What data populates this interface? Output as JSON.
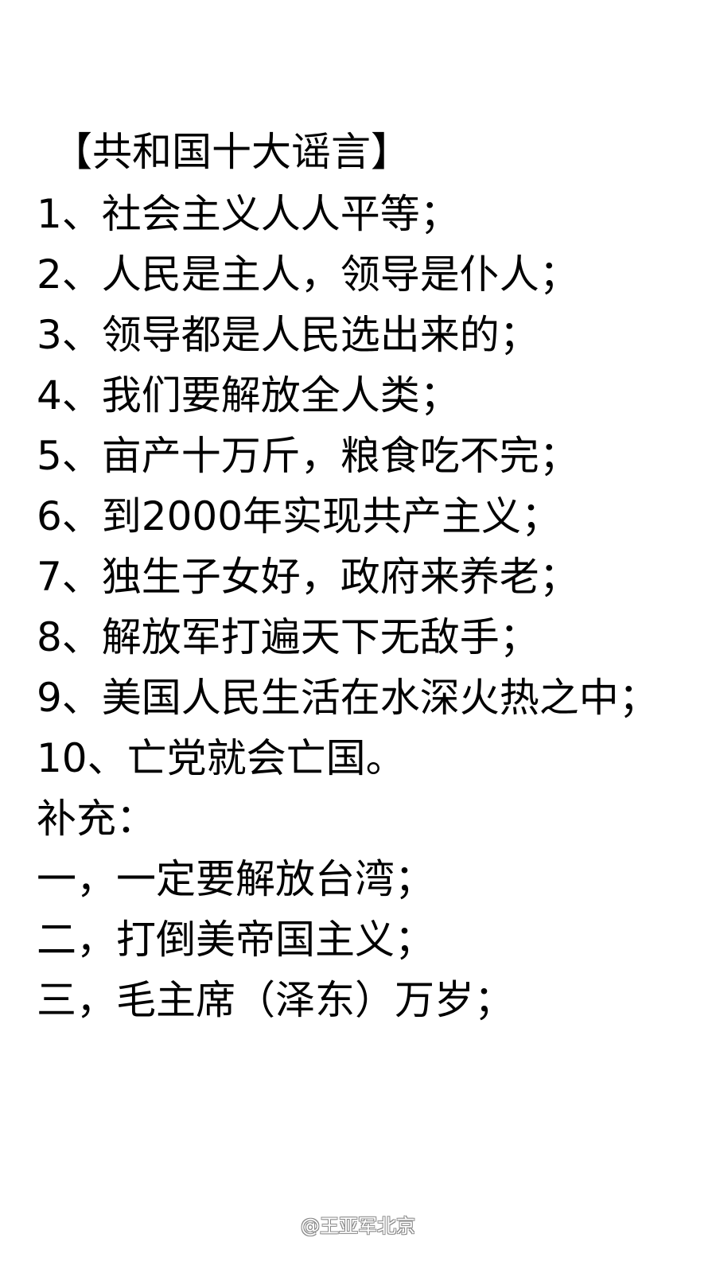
{
  "document": {
    "title": "【共和国十大谣言】",
    "items": [
      "1、社会主义人人平等；",
      "2、人民是主人，领导是仆人；",
      "3、领导都是人民选出来的；",
      "4、我们要解放全人类；",
      "5、亩产十万斤，粮食吃不完；",
      "6、到2000年实现共产主义；",
      "7、独生子女好，政府来养老；",
      "8、解放军打遍天下无敌手；",
      "9、美国人民生活在水深火热之中；",
      "10、亡党就会亡国。"
    ],
    "supplement_label": "补充：",
    "supplement_items": [
      "一，一定要解放台湾；",
      "二，打倒美帝国主义；",
      "三，毛主席（泽东）万岁；"
    ]
  },
  "watermark": {
    "text": "@王亚军北京"
  }
}
